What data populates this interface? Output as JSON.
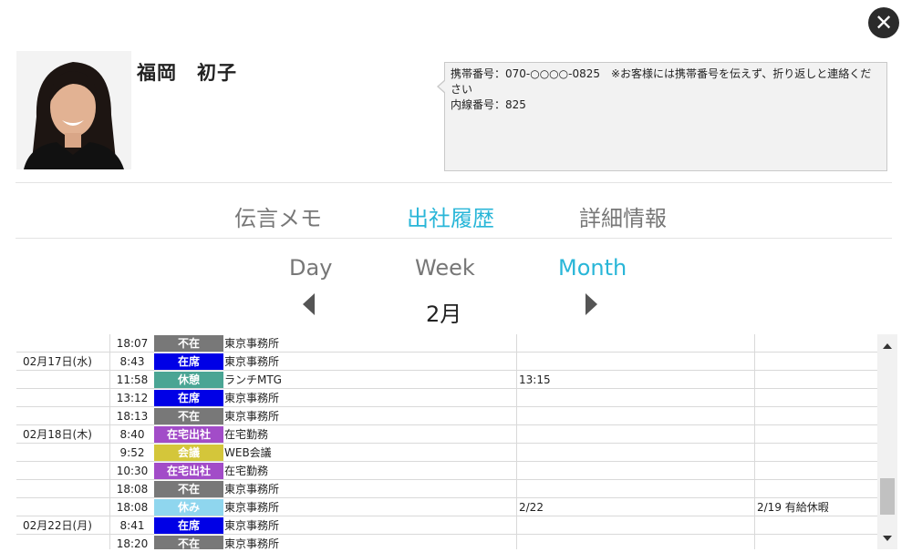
{
  "close_label": "✕",
  "profile": {
    "name": "福岡　初子",
    "memo_lines": [
      "携帯番号：070-○○○○-0825　※お客様には携帯番号を伝えず、折り返しと連絡ください",
      "内線番号：825"
    ]
  },
  "tabs": [
    {
      "label": "伝言メモ",
      "active": false
    },
    {
      "label": "出社履歴",
      "active": true
    },
    {
      "label": "詳細情報",
      "active": false
    }
  ],
  "views": [
    {
      "label": "Day",
      "active": false
    },
    {
      "label": "Week",
      "active": false
    },
    {
      "label": "Month",
      "active": true
    }
  ],
  "month_label": "2月",
  "status_colors": {
    "不在": "#787878",
    "在席": "#0000e6",
    "休憩": "#4aa594",
    "在宅出社": "#a24cc8",
    "会議": "#d4c63a",
    "休み": "#8fd6ee"
  },
  "rows": [
    {
      "date": "",
      "time": "18:07",
      "status": "不在",
      "note": "東京事務所",
      "return": "",
      "remark": ""
    },
    {
      "date": "02月17日(水)",
      "time": "8:43",
      "status": "在席",
      "note": "東京事務所",
      "return": "",
      "remark": ""
    },
    {
      "date": "",
      "time": "11:58",
      "status": "休憩",
      "note": "ランチMTG",
      "return": "13:15",
      "remark": ""
    },
    {
      "date": "",
      "time": "13:12",
      "status": "在席",
      "note": "東京事務所",
      "return": "",
      "remark": ""
    },
    {
      "date": "",
      "time": "18:13",
      "status": "不在",
      "note": "東京事務所",
      "return": "",
      "remark": ""
    },
    {
      "date": "02月18日(木)",
      "time": "8:40",
      "status": "在宅出社",
      "note": "在宅勤務",
      "return": "",
      "remark": ""
    },
    {
      "date": "",
      "time": "9:52",
      "status": "会議",
      "note": "WEB会議",
      "return": "",
      "remark": ""
    },
    {
      "date": "",
      "time": "10:30",
      "status": "在宅出社",
      "note": "在宅勤務",
      "return": "",
      "remark": ""
    },
    {
      "date": "",
      "time": "18:08",
      "status": "不在",
      "note": "東京事務所",
      "return": "",
      "remark": ""
    },
    {
      "date": "",
      "time": "18:08",
      "status": "休み",
      "note": "東京事務所",
      "return": "2/22",
      "remark": "2/19 有給休暇"
    },
    {
      "date": "02月22日(月)",
      "time": "8:41",
      "status": "在席",
      "note": "東京事務所",
      "return": "",
      "remark": ""
    },
    {
      "date": "",
      "time": "18:20",
      "status": "不在",
      "note": "東京事務所",
      "return": "",
      "remark": ""
    }
  ]
}
